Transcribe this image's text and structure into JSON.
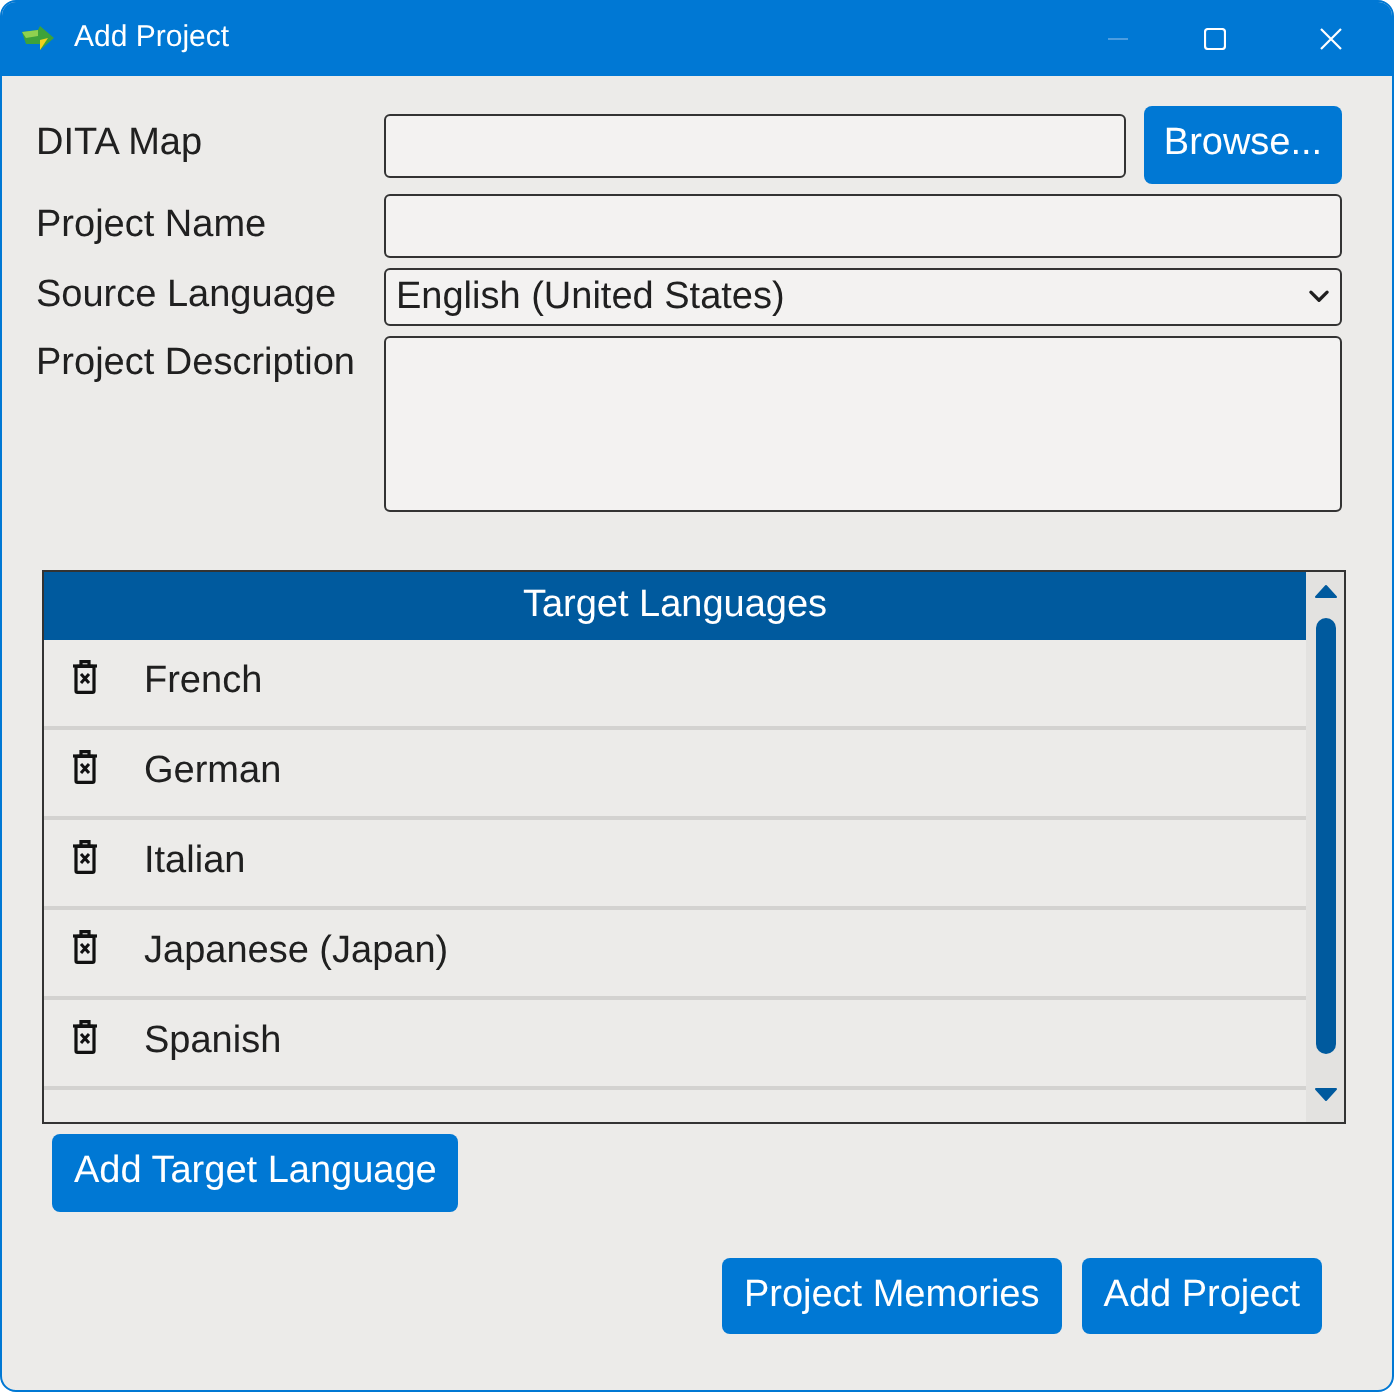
{
  "window": {
    "title": "Add Project",
    "controls": [
      {
        "kind": "minimize",
        "disabled": true
      },
      {
        "kind": "maximize",
        "disabled": false
      },
      {
        "kind": "close",
        "disabled": false
      }
    ]
  },
  "fields": [
    {
      "kind": "file",
      "label": "DITA Map",
      "button": "Browse..."
    },
    {
      "kind": "text",
      "label": "Project Name"
    },
    {
      "kind": "select",
      "label": "Source Language",
      "value": "English (United States)"
    },
    {
      "kind": "textarea",
      "label": "Project Description"
    }
  ],
  "target_languages": {
    "header": "Target Languages",
    "items": [
      "French",
      "German",
      "Italian",
      "Japanese (Japan)",
      "Spanish"
    ]
  },
  "add_target_button": "Add Target Language",
  "buttons": [
    "Project Memories",
    "Add Project"
  ]
}
